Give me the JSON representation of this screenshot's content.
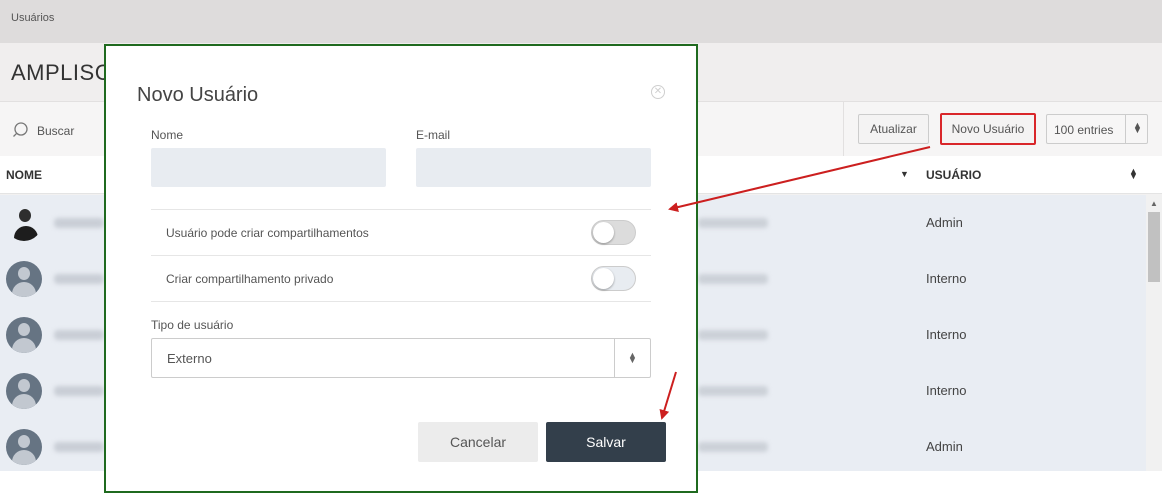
{
  "breadcrumb": "Usuários",
  "page_title": "AMPLISC",
  "toolbar": {
    "search_label": "Buscar",
    "refresh_label": "Atualizar",
    "new_user_label": "Novo Usuário",
    "entries_label": "100 entries"
  },
  "table": {
    "headers": {
      "name": "NOME",
      "user_type": "USUÁRIO"
    },
    "rows": [
      {
        "role": "Admin"
      },
      {
        "role": "Interno"
      },
      {
        "role": "Interno"
      },
      {
        "role": "Interno"
      },
      {
        "role": "Admin"
      }
    ]
  },
  "modal": {
    "title": "Novo Usuário",
    "name_label": "Nome",
    "name_value": "",
    "email_label": "E-mail",
    "email_value": "",
    "option_can_share": {
      "label": "Usuário pode criar compartilhamentos",
      "enabled": false
    },
    "option_private_share": {
      "label": "Criar compartilhamento privado",
      "enabled": false
    },
    "type_label": "Tipo de usuário",
    "type_value": "Externo",
    "cancel_label": "Cancelar",
    "save_label": "Salvar"
  },
  "colors": {
    "highlight_border": "#d9262a",
    "modal_border": "#1f6a1f",
    "save_button": "#333f4b",
    "annotation_arrow": "#cc1f1f"
  },
  "icons": {
    "search": "search-icon",
    "close": "close-icon",
    "sort": "sort-icon",
    "caret": "caret-down-icon"
  }
}
